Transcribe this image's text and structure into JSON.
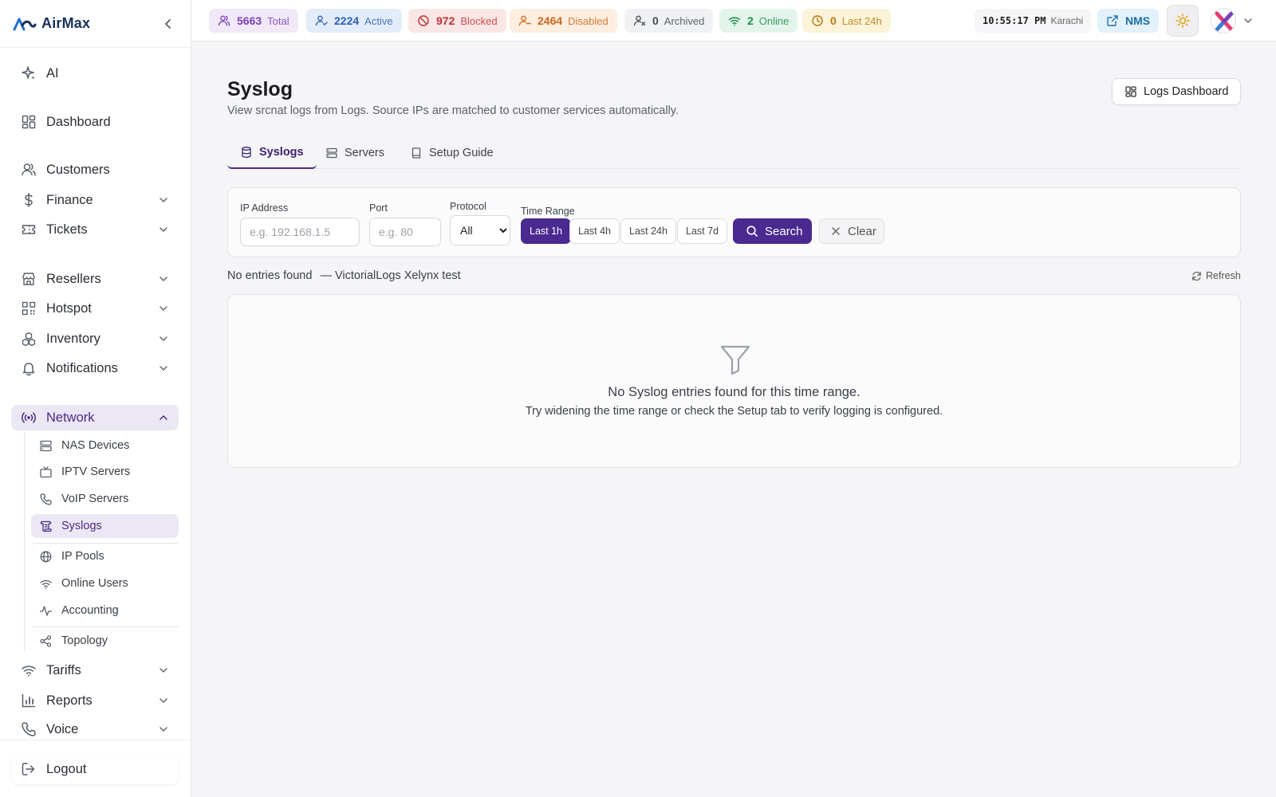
{
  "brand": {
    "name": "AirMax"
  },
  "sidebar": {
    "items": [
      {
        "label": "AI"
      },
      {
        "label": "Dashboard"
      },
      {
        "label": "Customers"
      },
      {
        "label": "Finance"
      },
      {
        "label": "Tickets"
      },
      {
        "label": "Resellers"
      },
      {
        "label": "Hotspot"
      },
      {
        "label": "Inventory"
      },
      {
        "label": "Notifications"
      },
      {
        "label": "Network"
      },
      {
        "label": "Tariffs"
      },
      {
        "label": "Reports"
      },
      {
        "label": "Voice"
      }
    ],
    "network_sub": [
      {
        "label": "NAS Devices"
      },
      {
        "label": "IPTV Servers"
      },
      {
        "label": "VoIP Servers"
      },
      {
        "label": "Syslogs"
      },
      {
        "label": "IP Pools"
      },
      {
        "label": "Online Users"
      },
      {
        "label": "Accounting"
      },
      {
        "label": "Topology"
      }
    ],
    "logout": "Logout"
  },
  "topbar": {
    "stats": [
      {
        "value": "5663",
        "label": "Total",
        "color": "#7b3fb8",
        "bg": "#f1e8f8"
      },
      {
        "value": "2224",
        "label": "Active",
        "color": "#2a5fb8",
        "bg": "#e3ecfa"
      },
      {
        "value": "972",
        "label": "Blocked",
        "color": "#c53030",
        "bg": "#fbe6e6"
      },
      {
        "value": "2464",
        "label": "Disabled",
        "color": "#d0661a",
        "bg": "#fdeedf"
      },
      {
        "value": "0",
        "label": "Archived",
        "color": "#444b55",
        "bg": "#f0f1f3"
      },
      {
        "value": "2",
        "label": "Online",
        "color": "#1f8a4c",
        "bg": "#e3f5ea"
      },
      {
        "value": "0",
        "label": "Last 24h",
        "color": "#b57a0a",
        "bg": "#fcf3d8"
      }
    ],
    "clock": {
      "time": "10:55:17 PM",
      "tz": "Karachi"
    },
    "nms": "NMS"
  },
  "page": {
    "title": "Syslog",
    "subtitle": "View srcnat logs from Logs. Source IPs are matched to customer services automatically.",
    "logs_dashboard": "Logs Dashboard",
    "tabs": [
      {
        "label": "Syslogs"
      },
      {
        "label": "Servers"
      },
      {
        "label": "Setup Guide"
      }
    ]
  },
  "filters": {
    "ip": {
      "label": "IP Address",
      "placeholder": "e.g. 192.168.1.5"
    },
    "port": {
      "label": "Port",
      "placeholder": "e.g. 80"
    },
    "protocol": {
      "label": "Protocol",
      "selected": "All"
    },
    "time_range": {
      "label": "Time Range",
      "options": [
        "Last 1h",
        "Last 4h",
        "Last 24h",
        "Last 7d"
      ]
    },
    "search": "Search",
    "clear": "Clear"
  },
  "results": {
    "status": "No entries found",
    "source": "— VictorialLogs Xelynx test",
    "refresh": "Refresh",
    "empty_title": "No Syslog entries found for this time range.",
    "empty_sub": "Try widening the time range or check the Setup tab to verify logging is configured."
  }
}
